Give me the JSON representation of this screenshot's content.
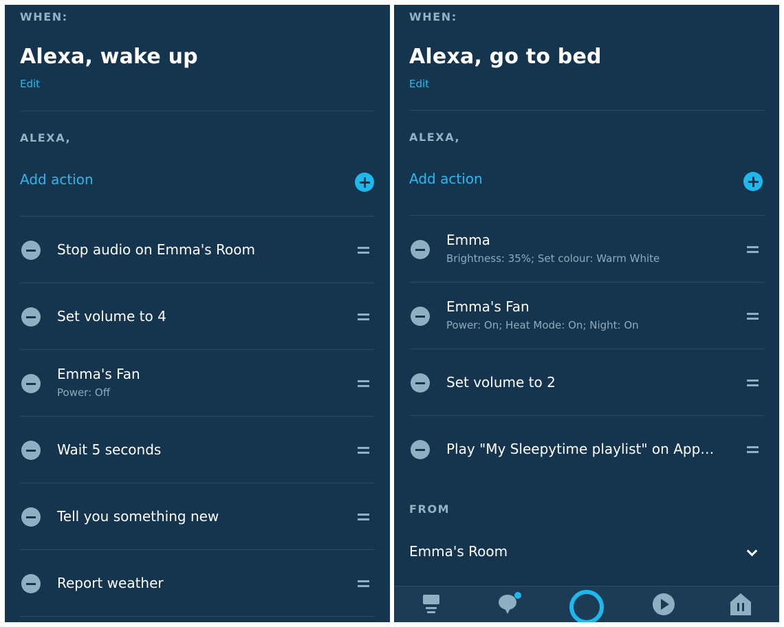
{
  "left": {
    "when_label": "WHEN:",
    "title": "Alexa, wake up",
    "edit_label": "Edit",
    "alexa_label": "ALEXA,",
    "add_action_label": "Add action",
    "actions": [
      {
        "title": "Stop audio on Emma's Room"
      },
      {
        "title": "Set volume to 4"
      },
      {
        "title": "Emma's Fan",
        "subtitle": "Power: Off"
      },
      {
        "title": "Wait 5 seconds"
      },
      {
        "title": "Tell you something new"
      },
      {
        "title": "Report weather"
      }
    ]
  },
  "right": {
    "when_label": "WHEN:",
    "title": "Alexa, go to bed",
    "edit_label": "Edit",
    "alexa_label": "ALEXA,",
    "add_action_label": "Add action",
    "actions": [
      {
        "title": "Emma",
        "subtitle": "Brightness: 35%; Set colour: Warm White"
      },
      {
        "title": "Emma's Fan",
        "subtitle": "Power: On; Heat Mode: On; Night: On"
      },
      {
        "title": "Set volume to 2"
      },
      {
        "title": "Play \"My Sleepytime playlist\" on Apple Music"
      }
    ],
    "from_label": "FROM",
    "from_value": "Emma's Room"
  },
  "bottom_nav": {
    "items": [
      {
        "icon": "home-icon"
      },
      {
        "icon": "communicate-icon",
        "notification": true
      },
      {
        "icon": "alexa-icon",
        "active": true
      },
      {
        "icon": "play-icon"
      },
      {
        "icon": "devices-icon"
      }
    ]
  },
  "colors": {
    "background": "#15354f",
    "accent": "#1fb8ec",
    "muted": "#8fb0c3",
    "divider": "#2c4c66"
  }
}
